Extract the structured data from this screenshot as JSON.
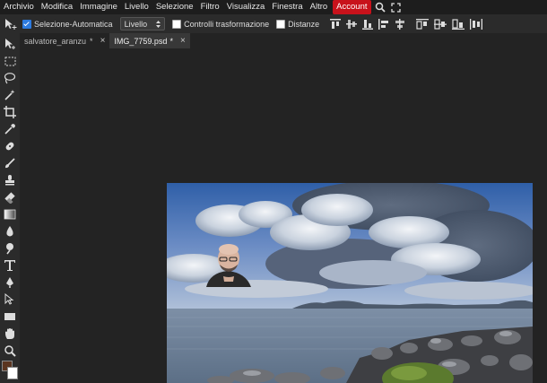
{
  "menu": {
    "items": [
      "Archivio",
      "Modifica",
      "Immagine",
      "Livello",
      "Selezione",
      "Filtro",
      "Visualizza",
      "Finestra",
      "Altro"
    ],
    "account": "Account"
  },
  "options": {
    "auto_select_label": "Selezione-Automatica",
    "auto_select_checked": true,
    "layer_select_value": "Livello",
    "transform_controls_label": "Controlli trasformazione",
    "distances_label": "Distanze"
  },
  "tabs": [
    {
      "label": "salvatore_aranzu",
      "modified": "*",
      "close": "×"
    },
    {
      "label": "IMG_7759.psd",
      "modified": "*",
      "close": "×"
    }
  ],
  "colors": {
    "account_bg": "#c8121b",
    "foreground_swatch": "#5b3520",
    "background_swatch": "#ffffff"
  }
}
